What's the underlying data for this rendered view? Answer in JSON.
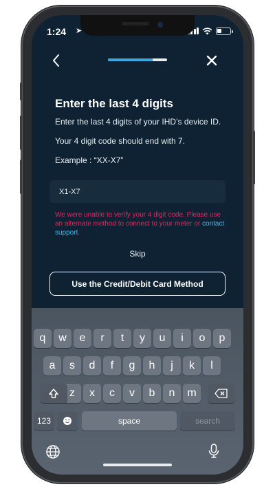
{
  "status": {
    "time": "1:24",
    "location_glyph": "➤"
  },
  "nav": {
    "progress": 0.75
  },
  "content": {
    "title": "Enter the last 4 digits",
    "instruction": "Enter the last 4 digits of your IHD’s device ID.",
    "hint": "Your 4 digit code should end with 7.",
    "example": "Example : “XX-X7”",
    "input_value": "X1-X7",
    "error_text": "We were unable to verify your 4 digit code. Please use an alternate method to connect to your meter or ",
    "error_link": "contact support",
    "error_end": ".",
    "skip": "Skip",
    "card_button": "Use the Credit/Debit Card Method"
  },
  "keyboard": {
    "row1": [
      "q",
      "w",
      "e",
      "r",
      "t",
      "y",
      "u",
      "i",
      "o",
      "p"
    ],
    "row2": [
      "a",
      "s",
      "d",
      "f",
      "g",
      "h",
      "j",
      "k",
      "l"
    ],
    "row3": [
      "z",
      "x",
      "c",
      "v",
      "b",
      "n",
      "m"
    ],
    "numbers": "123",
    "space": "space",
    "search": "search"
  },
  "colors": {
    "accent": "#3aa7e1",
    "error": "#e5245e",
    "link": "#42b5e8",
    "background": "#0e2233"
  }
}
